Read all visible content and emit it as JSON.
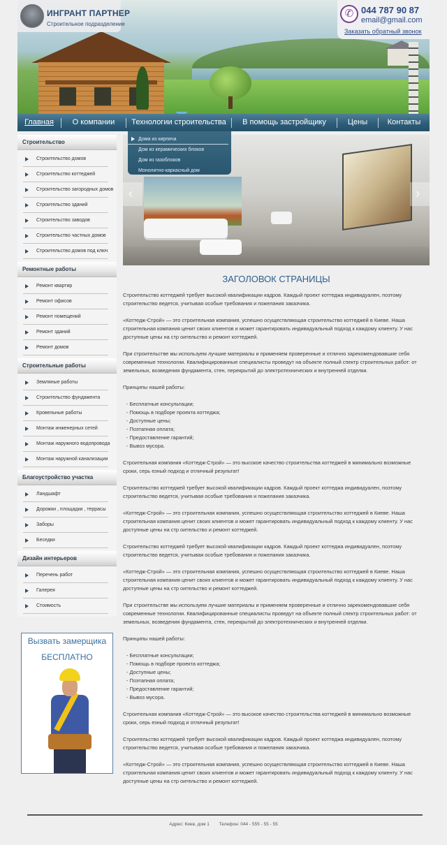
{
  "header": {
    "logo_name": "ИНГРАНТ ПАРТНЕР",
    "logo_sub": "Строительное подразделение",
    "phone": "044 787 90 87",
    "email": "email@gmail.com",
    "callback": "Заказать обратный звонок"
  },
  "nav": {
    "items": [
      {
        "label": "Главная"
      },
      {
        "label": "О компании"
      },
      {
        "label": "Технологии строительства"
      },
      {
        "label": "В помощь застройщику"
      },
      {
        "label": "Цены"
      },
      {
        "label": "Контакты"
      }
    ],
    "active_index": 0,
    "dropdown": [
      "Дома из кирпича",
      "Дом из керамических блоков",
      "Дом из газоблоков",
      "Монолитно-каркасный дом"
    ]
  },
  "sidebar": {
    "sections": [
      {
        "title": "Строительство",
        "items": [
          "Строительство домов",
          "Строительство коттеджей",
          "Строительство загородных домов",
          "Строительство зданий",
          "Строительство заводов",
          "Строительство частных домов",
          "Строительство домов под ключ"
        ]
      },
      {
        "title": "Ремонтные работы",
        "items": [
          "Ремонт квартир",
          "Ремонт офисов",
          "Ремонт помещений",
          "Ремонт зданий",
          "Ремонт домов"
        ]
      },
      {
        "title": "Строительные работы",
        "items": [
          "Земляные работы",
          "Строительство фундамента",
          "Кровельные работы",
          "Монтаж инженерных сетей",
          "Монтаж наружного водопровода",
          "Монтаж наружной канализации"
        ]
      },
      {
        "title": "Благоустройство участка",
        "items": [
          "Ландшафт",
          "Дорожки , площадки , террасы",
          "Заборы",
          "Беседки"
        ]
      },
      {
        "title": "Дизайн интерьеров",
        "items": [
          "Перечень работ",
          "Галерея",
          "Стоимость"
        ]
      }
    ],
    "banner": {
      "title": "Вызвать замерщика",
      "subtitle": "БЕСПЛАТНО"
    }
  },
  "main": {
    "title": "ЗАГОЛОВОК СТРАНИЦЫ",
    "slider": {
      "prev": "‹",
      "next": "›"
    },
    "p1": "Строительство коттеджей требует высокой квалификации кадров. Каждый проект коттеджа индивидуален, поэтому строительство ведется, учитывая особые требования и пожелания заказчика.",
    "p2": "«Коттедж-Строй» — это строительная компания, успешно осуществляющая строительство коттеджей в Киеве. Наша строительная компания ценит своих клиентов и может гарантировать индивидуальный подход к каждому клиенту. У нас доступные цены на стр оительство и ремонт коттеджей.",
    "p3": "При строительстве мы используем лучшие материалы и применяем проверенные и отлично зарекомендовавшие себя современные технологии. Квалифицированные специалисты проведут на объекте полный спектр строительных работ: от земельных, возведения фундамента, стен, перекрытий до электротехнических и внутренней отделки.",
    "principles_title": "Принципы нашей работы:",
    "principles": [
      "- Бесплатные консультации;",
      "- Помощь в подборе проекта коттеджа;",
      "- Доступные цены;",
      "- Поэтапная оплата;",
      "- Предоставление гарантий;",
      "- Вывоз мусора."
    ],
    "p4": "Строительная компания «Коттедж-Строй» — это высокое качество строительства коттеджей в минимально возможные сроки, серь езный подход и отличный результат!"
  },
  "footer": {
    "address": "Адрес: Киев, дом 1",
    "phone": "Телефон: 044 - 555 - 55 - 55"
  }
}
